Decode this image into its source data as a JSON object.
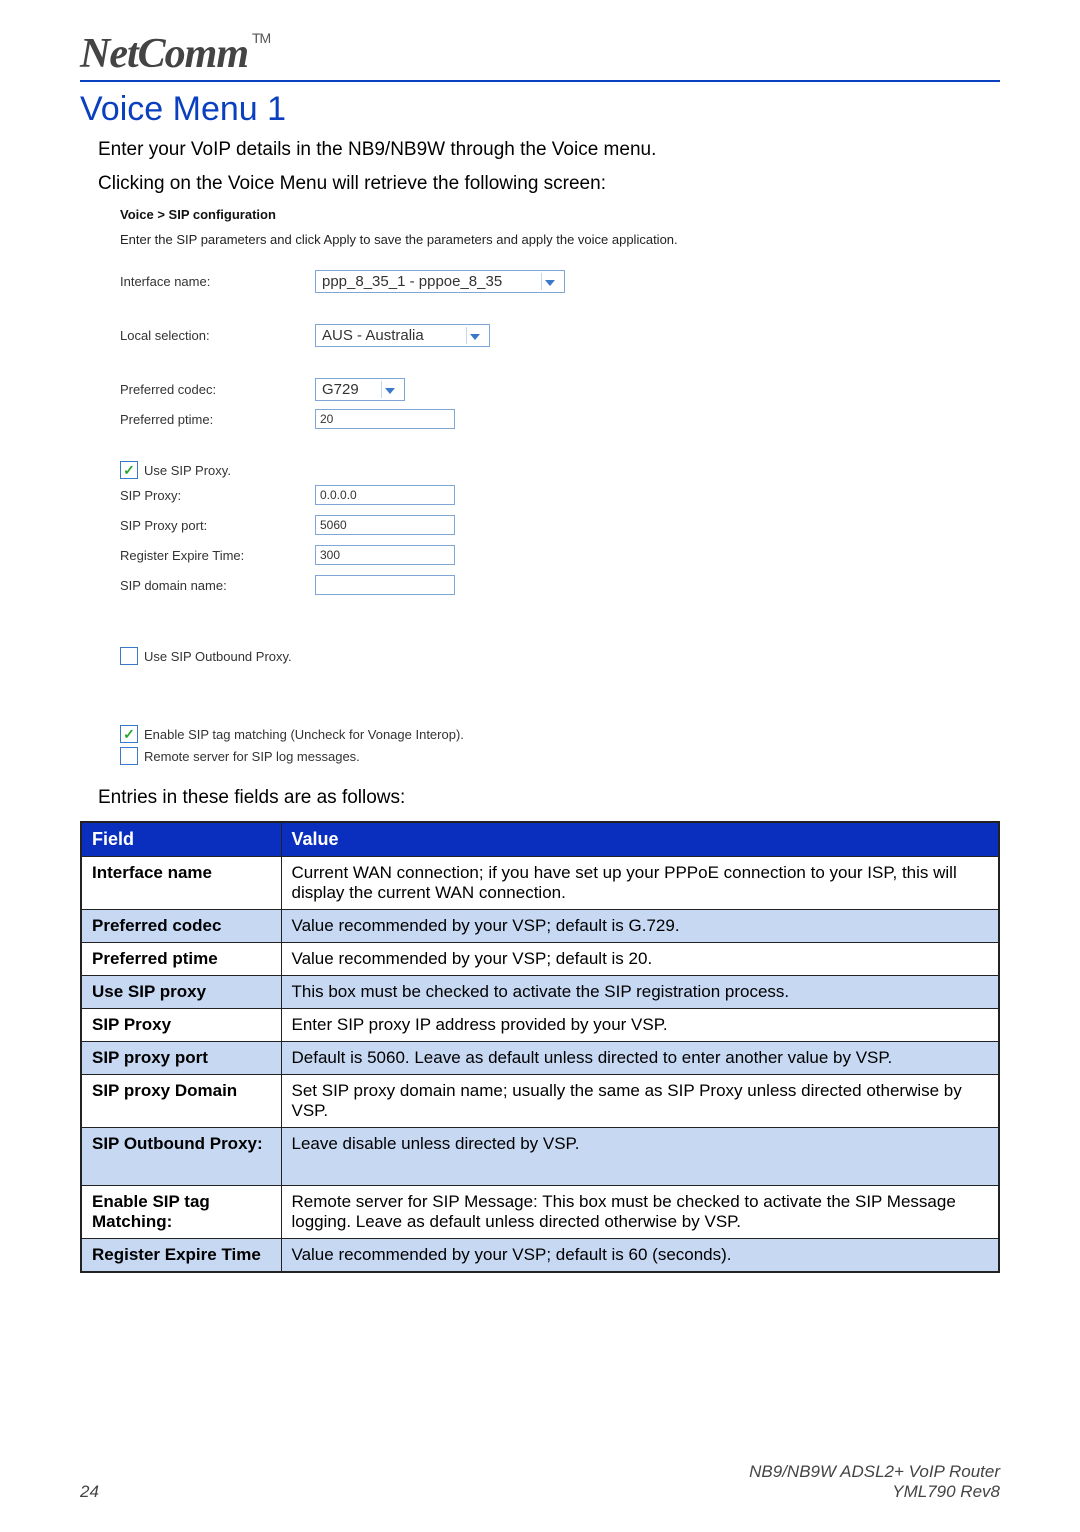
{
  "logo": {
    "brand": "NetComm",
    "tm": "TM"
  },
  "title": "Voice Menu 1",
  "intro1": "Enter your VoIP details in the NB9/NB9W through the Voice menu.",
  "intro2": "Clicking on the Voice Menu will retrieve the following screen:",
  "config": {
    "breadcrumb": "Voice > SIP configuration",
    "instruction": "Enter the SIP parameters and click Apply to save the parameters and apply the voice application.",
    "rows": {
      "iface_label": "Interface name:",
      "iface_value": "ppp_8_35_1 - pppoe_8_35",
      "local_label": "Local selection:",
      "local_value": "AUS - Australia",
      "codec_label": "Preferred codec:",
      "codec_value": "G729",
      "ptime_label": "Preferred ptime:",
      "ptime_value": "20",
      "use_proxy_label": "Use SIP Proxy.",
      "sip_proxy_label": "SIP Proxy:",
      "sip_proxy_value": "0.0.0.0",
      "sip_port_label": "SIP Proxy port:",
      "sip_port_value": "5060",
      "reg_expire_label": "Register Expire Time:",
      "reg_expire_value": "300",
      "sip_domain_label": "SIP domain name:",
      "sip_domain_value": "",
      "outbound_label": "Use SIP Outbound Proxy.",
      "tag_match_label": "Enable SIP tag matching (Uncheck for Vonage Interop).",
      "remote_log_label": "Remote server for SIP log messages."
    }
  },
  "entries_caption": "Entries in these fields are as follows:",
  "table": {
    "header_field": "Field",
    "header_value": "Value",
    "rows": [
      {
        "field": "Interface name",
        "value": "Current WAN connection; if you have set up your PPPoE connection to your ISP, this will display the current WAN connection."
      },
      {
        "field": "Preferred codec",
        "value": "Value recommended by your VSP; default is G.729."
      },
      {
        "field": "Preferred ptime",
        "value": "Value recommended by your VSP; default is 20."
      },
      {
        "field": "Use SIP proxy",
        "value": "This box must be checked to activate the SIP registration process."
      },
      {
        "field": "SIP Proxy",
        "value": "Enter SIP proxy IP address provided by your VSP."
      },
      {
        "field": "SIP proxy port",
        "value": "Default is 5060. Leave as default unless directed to enter another value by VSP."
      },
      {
        "field": "SIP proxy Domain",
        "value": "Set SIP proxy domain name; usually the same as SIP Proxy unless directed otherwise by VSP."
      },
      {
        "field": "SIP Outbound Proxy:",
        "value": "Leave disable unless directed by VSP.",
        "tall": true
      },
      {
        "field": "Enable SIP tag Matching:",
        "value": "Remote server for SIP Message: This box must be checked to activate the SIP Message logging. Leave as default unless directed otherwise by VSP."
      },
      {
        "field": "Register Expire Time",
        "value": "Value recommended by your VSP; default is 60 (seconds)."
      }
    ]
  },
  "footer": {
    "page_num": "24",
    "product": "NB9/NB9W ADSL2+ VoIP Router",
    "doc": "YML790 Rev8"
  }
}
